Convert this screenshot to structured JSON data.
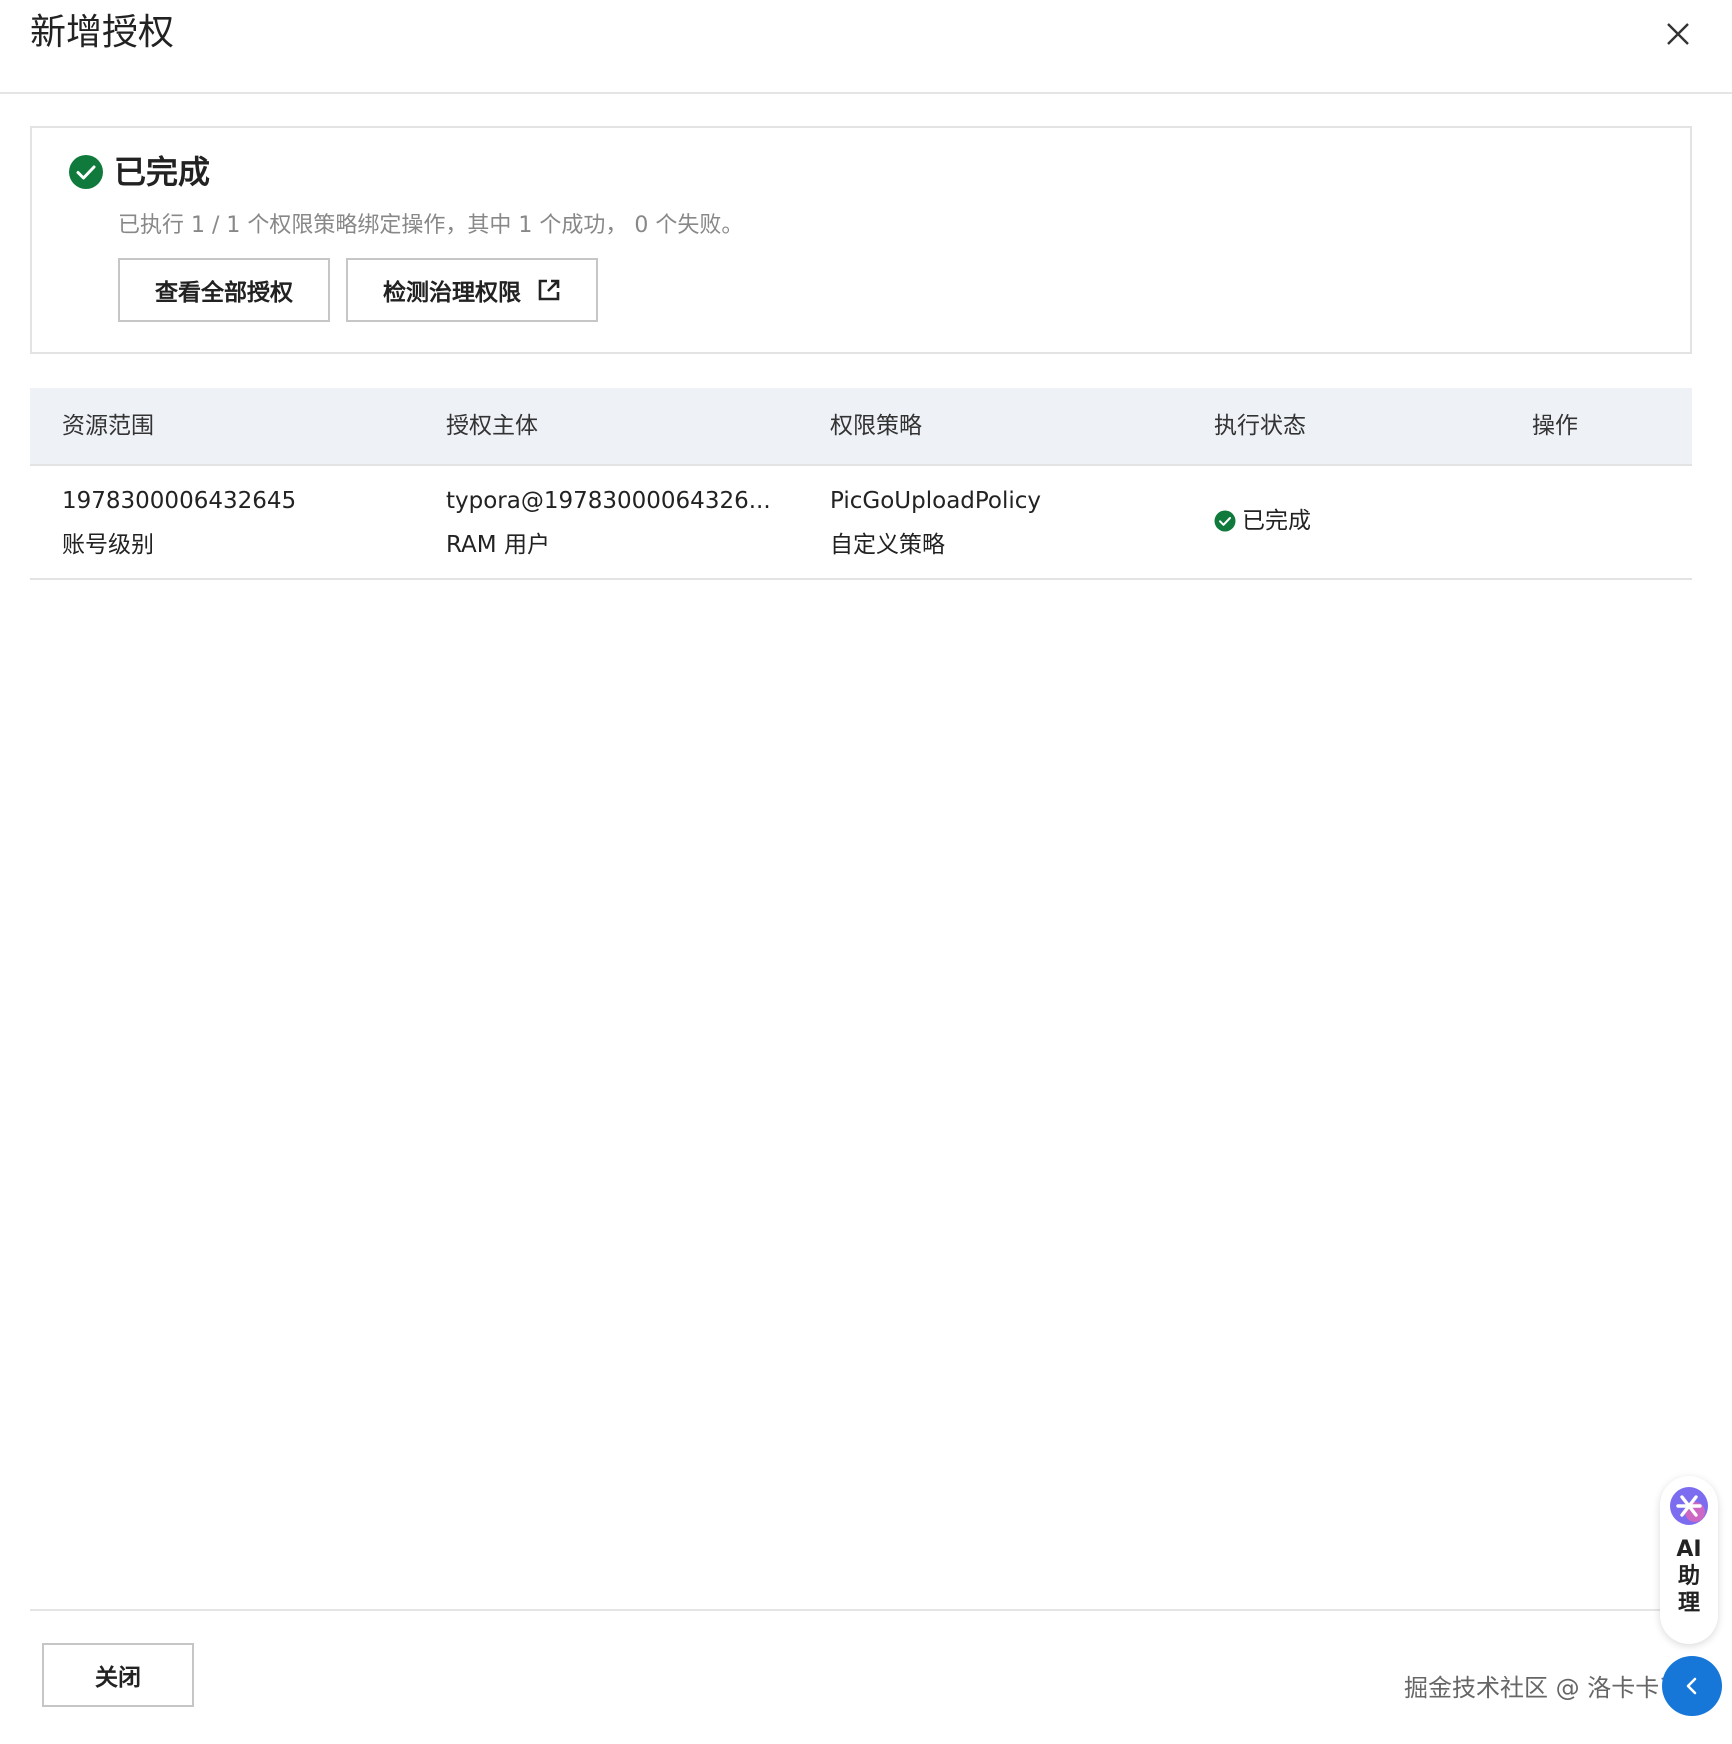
{
  "dialog": {
    "title": "新增授权"
  },
  "result": {
    "title": "已完成",
    "description": "已执行 1 / 1 个权限策略绑定操作，其中 1 个成功， 0 个失败。",
    "view_all_label": "查看全部授权",
    "detect_label": "检测治理权限"
  },
  "table": {
    "columns": [
      "资源范围",
      "授权主体",
      "权限策略",
      "执行状态",
      "操作"
    ],
    "rows": [
      {
        "scope": "1978300006432645",
        "scope_type": "账号级别",
        "principal": "typora@19783000064326...",
        "principal_type": "RAM 用户",
        "policy": "PicGoUploadPolicy",
        "policy_type": "自定义策略",
        "status": "已完成"
      }
    ]
  },
  "footer": {
    "close_label": "关闭"
  },
  "assistant": {
    "line1": "AI",
    "line2": "助",
    "line3": "理"
  },
  "watermark": "掘金技术社区 @ 洛卡卡了",
  "colors": {
    "success": "#0f7a3c",
    "accent": "#1677d9",
    "header_bg": "#eef2f7"
  }
}
